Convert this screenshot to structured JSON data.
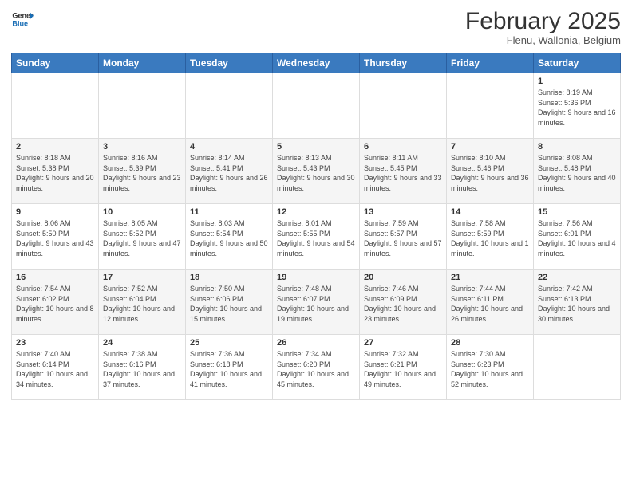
{
  "header": {
    "logo_general": "General",
    "logo_blue": "Blue",
    "title": "February 2025",
    "subtitle": "Flenu, Wallonia, Belgium"
  },
  "weekdays": [
    "Sunday",
    "Monday",
    "Tuesday",
    "Wednesday",
    "Thursday",
    "Friday",
    "Saturday"
  ],
  "weeks": [
    [
      {
        "day": "",
        "info": ""
      },
      {
        "day": "",
        "info": ""
      },
      {
        "day": "",
        "info": ""
      },
      {
        "day": "",
        "info": ""
      },
      {
        "day": "",
        "info": ""
      },
      {
        "day": "",
        "info": ""
      },
      {
        "day": "1",
        "info": "Sunrise: 8:19 AM\nSunset: 5:36 PM\nDaylight: 9 hours and 16 minutes."
      }
    ],
    [
      {
        "day": "2",
        "info": "Sunrise: 8:18 AM\nSunset: 5:38 PM\nDaylight: 9 hours and 20 minutes."
      },
      {
        "day": "3",
        "info": "Sunrise: 8:16 AM\nSunset: 5:39 PM\nDaylight: 9 hours and 23 minutes."
      },
      {
        "day": "4",
        "info": "Sunrise: 8:14 AM\nSunset: 5:41 PM\nDaylight: 9 hours and 26 minutes."
      },
      {
        "day": "5",
        "info": "Sunrise: 8:13 AM\nSunset: 5:43 PM\nDaylight: 9 hours and 30 minutes."
      },
      {
        "day": "6",
        "info": "Sunrise: 8:11 AM\nSunset: 5:45 PM\nDaylight: 9 hours and 33 minutes."
      },
      {
        "day": "7",
        "info": "Sunrise: 8:10 AM\nSunset: 5:46 PM\nDaylight: 9 hours and 36 minutes."
      },
      {
        "day": "8",
        "info": "Sunrise: 8:08 AM\nSunset: 5:48 PM\nDaylight: 9 hours and 40 minutes."
      }
    ],
    [
      {
        "day": "9",
        "info": "Sunrise: 8:06 AM\nSunset: 5:50 PM\nDaylight: 9 hours and 43 minutes."
      },
      {
        "day": "10",
        "info": "Sunrise: 8:05 AM\nSunset: 5:52 PM\nDaylight: 9 hours and 47 minutes."
      },
      {
        "day": "11",
        "info": "Sunrise: 8:03 AM\nSunset: 5:54 PM\nDaylight: 9 hours and 50 minutes."
      },
      {
        "day": "12",
        "info": "Sunrise: 8:01 AM\nSunset: 5:55 PM\nDaylight: 9 hours and 54 minutes."
      },
      {
        "day": "13",
        "info": "Sunrise: 7:59 AM\nSunset: 5:57 PM\nDaylight: 9 hours and 57 minutes."
      },
      {
        "day": "14",
        "info": "Sunrise: 7:58 AM\nSunset: 5:59 PM\nDaylight: 10 hours and 1 minute."
      },
      {
        "day": "15",
        "info": "Sunrise: 7:56 AM\nSunset: 6:01 PM\nDaylight: 10 hours and 4 minutes."
      }
    ],
    [
      {
        "day": "16",
        "info": "Sunrise: 7:54 AM\nSunset: 6:02 PM\nDaylight: 10 hours and 8 minutes."
      },
      {
        "day": "17",
        "info": "Sunrise: 7:52 AM\nSunset: 6:04 PM\nDaylight: 10 hours and 12 minutes."
      },
      {
        "day": "18",
        "info": "Sunrise: 7:50 AM\nSunset: 6:06 PM\nDaylight: 10 hours and 15 minutes."
      },
      {
        "day": "19",
        "info": "Sunrise: 7:48 AM\nSunset: 6:07 PM\nDaylight: 10 hours and 19 minutes."
      },
      {
        "day": "20",
        "info": "Sunrise: 7:46 AM\nSunset: 6:09 PM\nDaylight: 10 hours and 23 minutes."
      },
      {
        "day": "21",
        "info": "Sunrise: 7:44 AM\nSunset: 6:11 PM\nDaylight: 10 hours and 26 minutes."
      },
      {
        "day": "22",
        "info": "Sunrise: 7:42 AM\nSunset: 6:13 PM\nDaylight: 10 hours and 30 minutes."
      }
    ],
    [
      {
        "day": "23",
        "info": "Sunrise: 7:40 AM\nSunset: 6:14 PM\nDaylight: 10 hours and 34 minutes."
      },
      {
        "day": "24",
        "info": "Sunrise: 7:38 AM\nSunset: 6:16 PM\nDaylight: 10 hours and 37 minutes."
      },
      {
        "day": "25",
        "info": "Sunrise: 7:36 AM\nSunset: 6:18 PM\nDaylight: 10 hours and 41 minutes."
      },
      {
        "day": "26",
        "info": "Sunrise: 7:34 AM\nSunset: 6:20 PM\nDaylight: 10 hours and 45 minutes."
      },
      {
        "day": "27",
        "info": "Sunrise: 7:32 AM\nSunset: 6:21 PM\nDaylight: 10 hours and 49 minutes."
      },
      {
        "day": "28",
        "info": "Sunrise: 7:30 AM\nSunset: 6:23 PM\nDaylight: 10 hours and 52 minutes."
      },
      {
        "day": "",
        "info": ""
      }
    ]
  ]
}
